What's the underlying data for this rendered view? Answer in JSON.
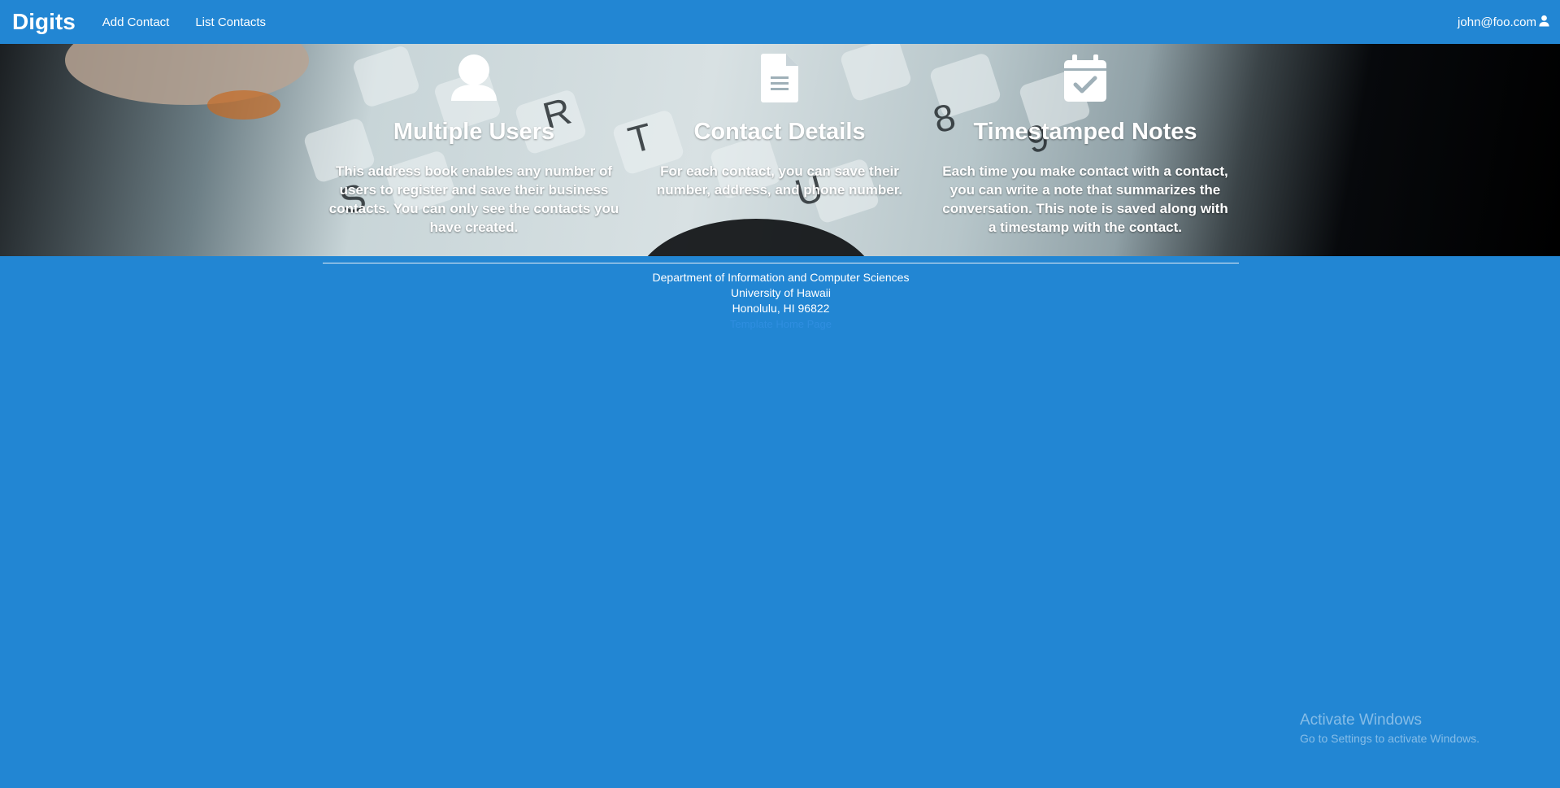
{
  "navbar": {
    "brand": "Digits",
    "links": [
      {
        "label": "Add Contact"
      },
      {
        "label": "List Contacts"
      }
    ],
    "user": "john@foo.com",
    "user_icon": "user-icon"
  },
  "features": [
    {
      "icon": "user-icon",
      "title": "Multiple Users",
      "text": "This address book enables any number of users to register and save their business contacts. You can only see the contacts you have created."
    },
    {
      "icon": "file-icon",
      "title": "Contact Details",
      "text": "For each contact, you can save their number, address, and phone number."
    },
    {
      "icon": "calendar-check-icon",
      "title": "Timestamped Notes",
      "text": "Each time you make contact with a contact, you can write a note that summarizes the conversation. This note is saved along with a timestamp with the contact."
    }
  ],
  "footer": {
    "line1": "Department of Information and Computer Sciences",
    "line2": "University of Hawaii",
    "line3": "Honolulu, HI 96822",
    "link": "Template Home Page"
  },
  "watermark": {
    "title": "Activate Windows",
    "subtitle": "Go to Settings to activate Windows."
  },
  "colors": {
    "background": "#2286d3",
    "text": "#ffffff"
  }
}
